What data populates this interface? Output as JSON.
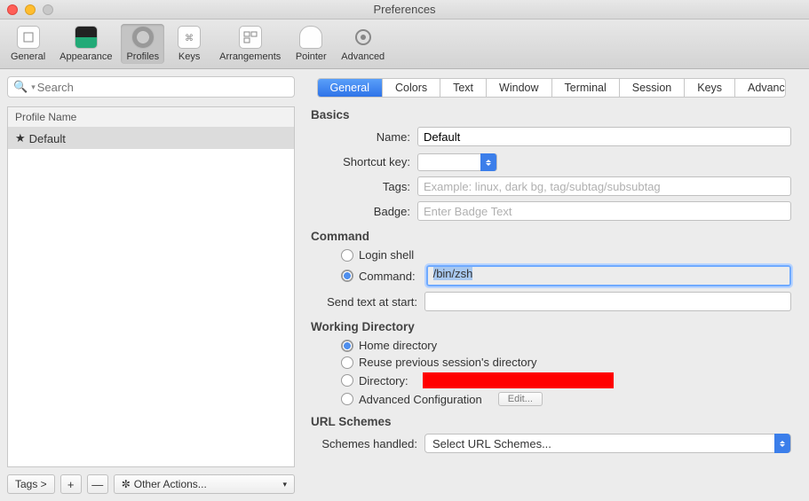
{
  "window": {
    "title": "Preferences"
  },
  "toolbar": {
    "items": [
      {
        "label": "General"
      },
      {
        "label": "Appearance"
      },
      {
        "label": "Profiles"
      },
      {
        "label": "Keys"
      },
      {
        "label": "Arrangements"
      },
      {
        "label": "Pointer"
      },
      {
        "label": "Advanced"
      }
    ],
    "active_index": 2
  },
  "left": {
    "search_placeholder": "Search",
    "profile_header": "Profile Name",
    "profiles": [
      "Default"
    ],
    "footer": {
      "tags_label": "Tags >",
      "plus": "+",
      "minus": "—",
      "other_actions": "Other Actions..."
    }
  },
  "tabs": {
    "items": [
      "General",
      "Colors",
      "Text",
      "Window",
      "Terminal",
      "Session",
      "Keys",
      "Advanced"
    ],
    "active_index": 0
  },
  "sections": {
    "basics": "Basics",
    "command": "Command",
    "working_dir": "Working Directory",
    "url_schemes": "URL Schemes"
  },
  "basics": {
    "name_label": "Name:",
    "name_value": "Default",
    "shortcut_label": "Shortcut key:",
    "tags_label": "Tags:",
    "tags_placeholder": "Example: linux, dark bg, tag/subtag/subsubtag",
    "badge_label": "Badge:",
    "badge_placeholder": "Enter Badge Text"
  },
  "command": {
    "login_shell": "Login shell",
    "command_label": "Command:",
    "command_value": "/bin/zsh",
    "selected_radio": "command",
    "send_text_label": "Send text at start:",
    "send_text_value": ""
  },
  "working_dir": {
    "home": "Home directory",
    "reuse": "Reuse previous session's directory",
    "directory": "Directory:",
    "advanced": "Advanced Configuration",
    "edit": "Edit...",
    "selected_radio": "home"
  },
  "url": {
    "label": "Schemes handled:",
    "value": "Select URL Schemes..."
  }
}
